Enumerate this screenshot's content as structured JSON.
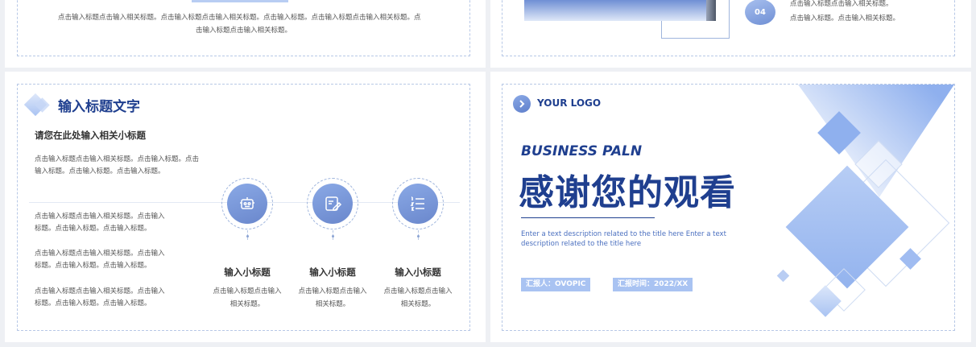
{
  "panel1": {
    "desc_line1": "点击输入标题点击输入相关标题。点击输入标题点击输入相关标题。点击输入标题。点击输入标题点击输入相关标题。点",
    "desc_line2": "击输入标题点击输入相关标题。"
  },
  "panel2": {
    "step_number": "04",
    "desc_line1": "点击输入标题点击输入相关标题。",
    "desc_line2": "点击输入标题。点击输入相关标题。"
  },
  "panel3": {
    "title": "输入标题文字",
    "subtitle": "请您在此处输入相关小标题",
    "intro_lines": [
      "点击输入标题点击输入相关标题。点击输入标题。点击",
      "输入标题。点击输入标题。点击输入标题。"
    ],
    "left_items": [
      [
        "点击输入标题点击输入相关标题。点击输入",
        "标题。点击输入标题。点击输入标题。"
      ],
      [
        "点击输入标题点击输入相关标题。点击输入",
        "标题。点击输入标题。点击输入标题。"
      ],
      [
        "点击输入标题点击输入相关标题。点击输入",
        "标题。点击输入标题。点击输入标题。"
      ]
    ],
    "features": [
      {
        "icon": "robot-icon",
        "title": "输入小标题",
        "desc_line1": "点击输入标题点击输入",
        "desc_line2": "相关标题。"
      },
      {
        "icon": "edit-icon",
        "title": "输入小标题",
        "desc_line1": "点击输入标题点击输入",
        "desc_line2": "相关标题。"
      },
      {
        "icon": "list-icon",
        "title": "输入小标题",
        "desc_line1": "点击输入标题点击输入",
        "desc_line2": "相关标题。"
      }
    ]
  },
  "panel4": {
    "logo_text": "YOUR LOGO",
    "kicker": "BUSINESS PALN",
    "headline": "感谢您的观看",
    "desc_line1": "Enter a text description related to the title here Enter a text",
    "desc_line2": "description related to the title here",
    "reporter": "汇报人：OVOPIC",
    "report_time": "汇报时间：2022/XX"
  },
  "colors": {
    "brand": "#1f3f8f",
    "accent": "#a9c3f2",
    "accent_dark": "#6a87cc",
    "text": "#333333",
    "muted": "#555555"
  }
}
